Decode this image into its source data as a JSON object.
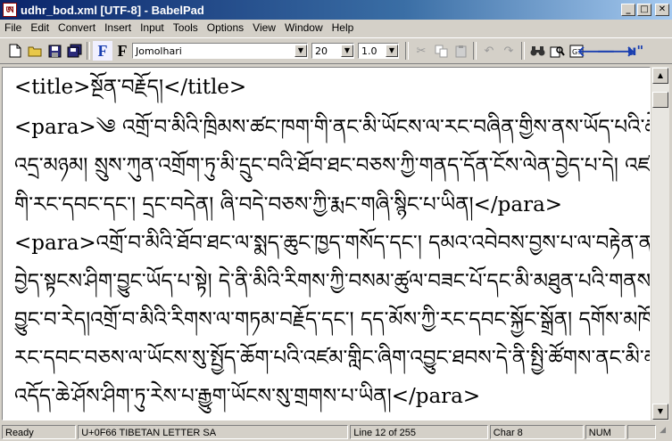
{
  "window": {
    "title": "udhr_bod.xml [UTF-8] - BabelPad",
    "app_icon_glyph": "ཨ"
  },
  "window_controls": {
    "minimize": "_",
    "maximize": "□",
    "close": "✕"
  },
  "menu": [
    "File",
    "Edit",
    "Convert",
    "Insert",
    "Input",
    "Tools",
    "Options",
    "View",
    "Window",
    "Help"
  ],
  "toolbar": {
    "font": "Jomolhari",
    "size": "20",
    "spacing": "1.0",
    "format_label_1": "F",
    "format_label_2": "F",
    "unicode_label": "u\""
  },
  "document": {
    "lines": [
      "<title>སྔོན་བརྗོད།</title>",
      "<para>༄ འགྲོ་བ་མིའི་ཁྲིམས་ཚང་ཁག་གི་ནང་མི་ཡོངས་ལ་རང་བཞིན་གྱིས་ནས་ཡོད་པའི་ཆེ་མཐོངས་དང་",
      "འདྲ་མཉམ། སྲུས་ཀུན་འགྲོག་ཏུ་མི་དྲུང་བའི་ཐོབ་ཐང་བཅས་ཀྱི་གནད་དོན་ངོས་ལེན་བྱེད་པ་དེ། འཛམ་གླིང་ནང་",
      "གི་རང་དབང་དང་། དྲང་བདེན། ཞི་བདེ་བཅས་ཀྱི་རྨང་གཞི་སྙིང་པ་ཡིན།</para>",
      "<para>འགྲོ་བ་མིའི་ཐོབ་ཐང་ལ་སྨད་ཆུང་ཁྱད་གསོད་དང་། དམའ་འབེབས་བྱས་པ་ལ་བརྟེན་ནས་ཀླུ་སྒྲོའི་",
      "བྱེད་སྟངས་ཤིག་བྱུང་ཡོད་པ་སྟེ། དེ་ནི་མིའི་རིགས་ཀྱི་བསམ་ཚུལ་བཟང་པོ་དང་མི་མཐུན་པའི་གནས་ཚུལ་ཞིག་",
      "བྱུང་བ་རེད།འགྲོ་བ་མིའི་རིགས་ལ་གཏམ་བརྗོད་དང་། དད་མོས་ཀྱི་རང་དབང་སྐྱོང་སྒྲོན། དགོས་མཁོ་སྐྱབ་པའི་",
      "རང་དབང་བཅས་ལ་ཡོངས་སུ་སྤྱོད་ཆོག་པའི་འཛམ་གླིང་ཞིག་འབྱུང་ཐབས་དེ་ནི་སྤྱི་ཚོགས་ནང་མི་མང་ཡོངས་ཀྱི་རེ་",
      "འདོད་ཆེ་ཤོས་ཤིག་ཏུ་རེས་པ་རྒྱུག་ཡོངས་སུ་གྲགས་པ་ཡིན།</para>"
    ]
  },
  "status": {
    "ready": "Ready",
    "char_info": "U+0F66 TIBETAN LETTER SA",
    "line": "Line 12 of 255",
    "char": "Char 8",
    "num": "NUM"
  },
  "scrollbar": {
    "up_arrow": "▲",
    "down_arrow": "▼",
    "resize_grip": "◢"
  }
}
